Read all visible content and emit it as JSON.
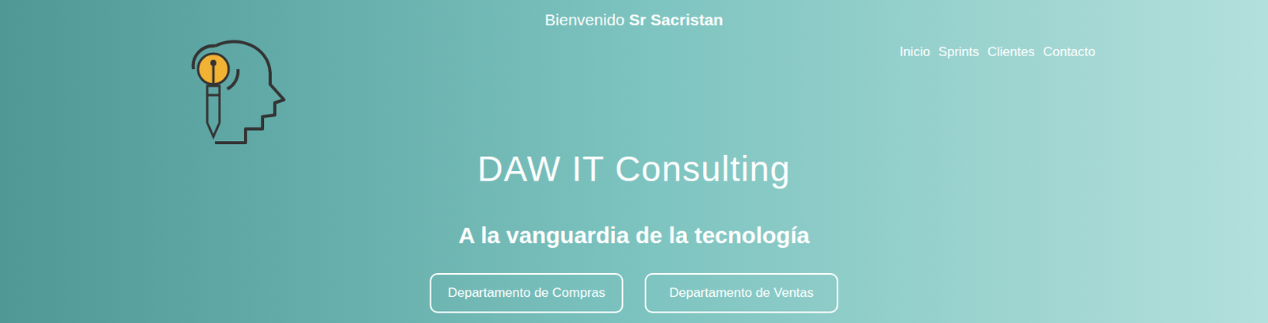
{
  "header": {
    "welcome_prefix": "Bienvenido",
    "user_name": "Sr Sacristan"
  },
  "nav": [
    {
      "label": "Inicio",
      "selected": false
    },
    {
      "label": "Sprints",
      "selected": false
    },
    {
      "label": "Clientes",
      "selected": false
    },
    {
      "label": "Contacto",
      "selected": false
    }
  ],
  "hero": {
    "title": "DAW IT Consulting",
    "subtitle": "A la vanguardia de la tecnología"
  },
  "buttons": [
    "Departamento de Compras",
    "Departamento de Ventas"
  ]
}
